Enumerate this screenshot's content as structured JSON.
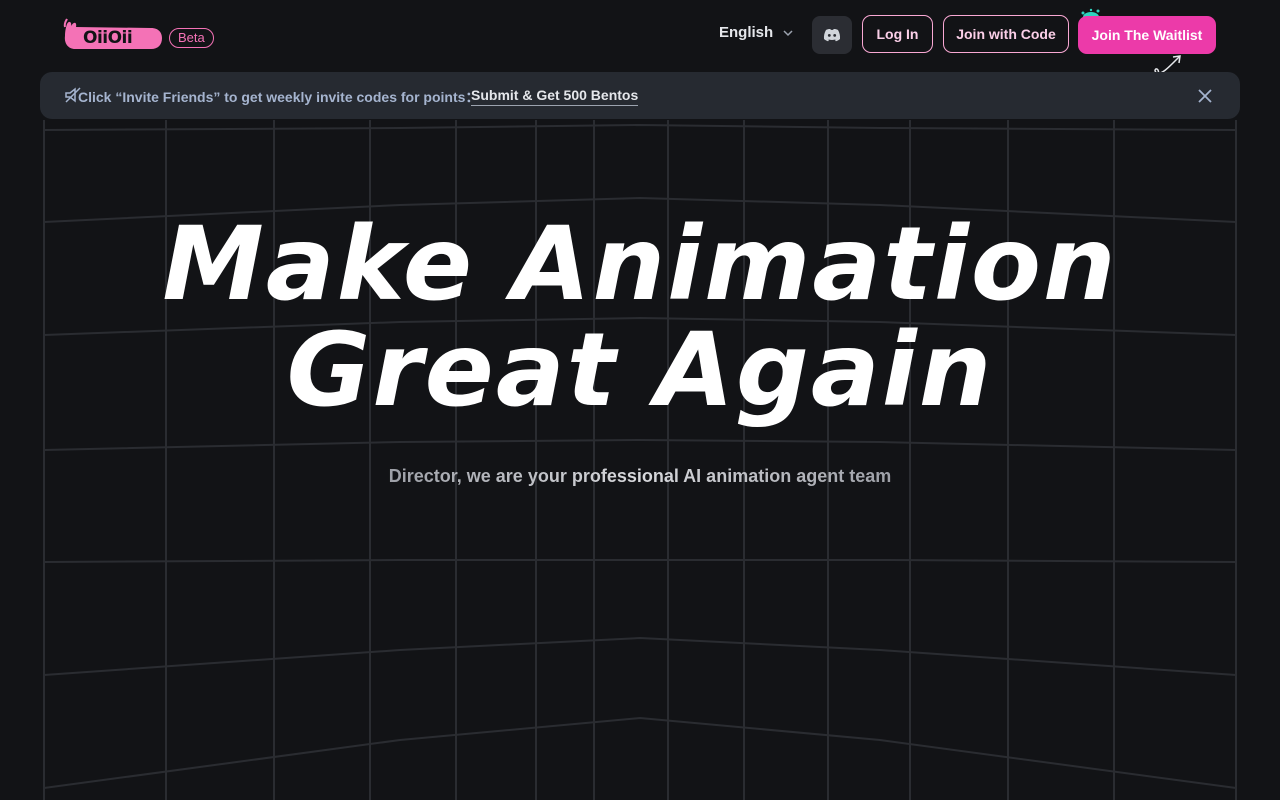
{
  "brand": {
    "logo_text": "OiiOii",
    "badge": "Beta",
    "accent_color": "#ec3aa9"
  },
  "header": {
    "language": "English",
    "discord_icon": "discord-icon",
    "login_label": "Log In",
    "join_code_label": "Join with Code",
    "waitlist_label": "Join The Waitlist"
  },
  "announcement": {
    "icon": "speaker-icon",
    "text": "Click “Invite Friends” to get weekly invite codes for points：",
    "link_label": "Submit & Get 500 Bentos",
    "close_icon": "close-icon"
  },
  "hero": {
    "title_line1": "Make Animation",
    "title_line2": "Great Again",
    "subtitle": "Director, we are your professional AI animation agent team"
  }
}
